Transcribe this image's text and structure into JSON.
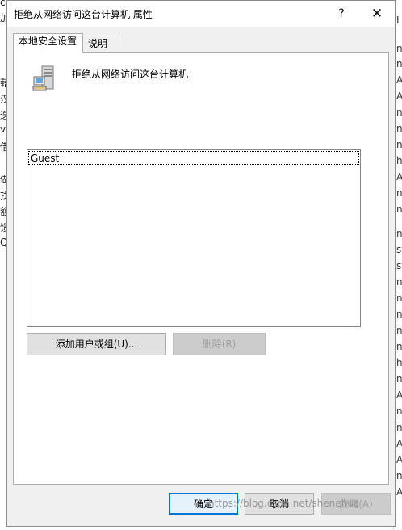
{
  "background": {
    "left_glyphs": [
      "c",
      "加",
      "",
      "藉",
      "汉",
      "迭",
      "v",
      "借",
      "",
      "做",
      "找",
      "额",
      "馈",
      "Q"
    ],
    "right_glyphs": [
      "I",
      "ni",
      "ni",
      "A",
      "A",
      "ni",
      "ni",
      "ni",
      "hi",
      "A",
      "ni",
      "ni",
      "ni",
      "st",
      "st",
      "ni",
      "ni",
      "ni",
      "ni",
      "ni",
      "hi",
      "ni",
      "A",
      "ni",
      "ni",
      "A",
      "A",
      "ni",
      "A"
    ]
  },
  "dialog": {
    "title": "拒绝从网络访问这台计算机 属性",
    "help_label": "?",
    "close_label": "✕"
  },
  "tabs": [
    {
      "label": "本地安全设置",
      "active": true
    },
    {
      "label": "说明",
      "active": false
    }
  ],
  "policy": {
    "icon": "server-computer-icon",
    "name": "拒绝从网络访问这台计算机"
  },
  "members": [
    "Guest"
  ],
  "buttons": {
    "add": "添加用户或组(U)...",
    "remove": "删除(R)",
    "ok": "确定",
    "cancel": "取消",
    "apply": "应用(A)"
  },
  "watermark": "https://blog.csdn.net/shenehua",
  "colors": {
    "focus_border": "#0078d7",
    "dialog_bg": "#f0f0f0",
    "disabled_text": "#a0a0a0"
  }
}
